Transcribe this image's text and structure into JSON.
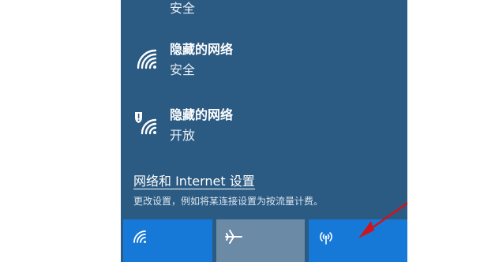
{
  "colors": {
    "flyout_bg": "#2b5a82",
    "tile_active": "#1679d8",
    "tile_inactive": "#6b8aa6",
    "arrow": "#d0141c"
  },
  "networks": [
    {
      "status": "安全",
      "icon": "wifi-icon"
    },
    {
      "name": "隐藏的网络",
      "status": "安全",
      "icon": "wifi-icon"
    },
    {
      "name": "隐藏的网络",
      "status": "开放",
      "icon": "wifi-warning-icon"
    }
  ],
  "settings": {
    "link": "网络和 Internet 设置",
    "description": "更改设置，例如将某连接设置为按流量计费。"
  },
  "quick_actions": [
    {
      "icon": "wifi-icon",
      "state": "on"
    },
    {
      "icon": "airplane-icon",
      "state": "off"
    },
    {
      "icon": "mobile-hotspot-icon",
      "state": "on"
    }
  ]
}
